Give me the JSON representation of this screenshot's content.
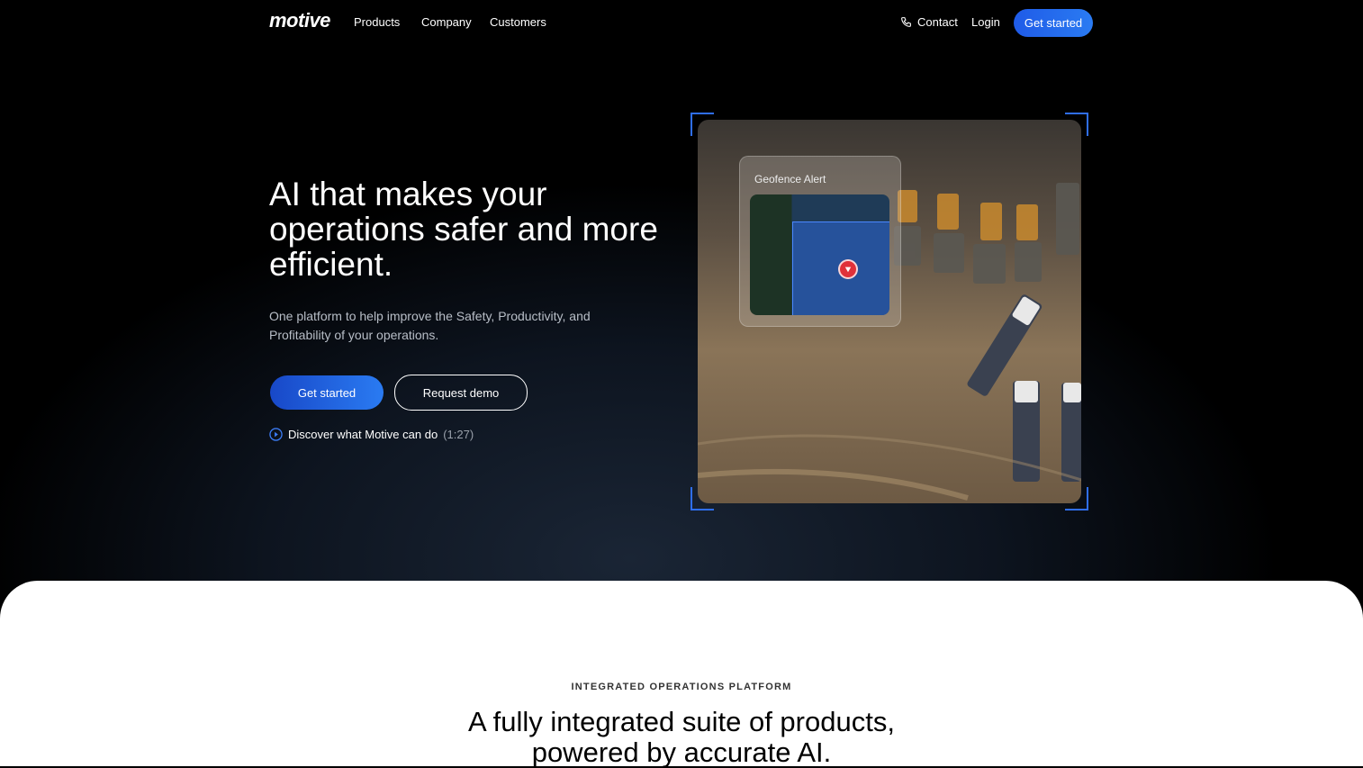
{
  "nav": {
    "logo": "motive",
    "links": [
      "Products",
      "Company",
      "Customers"
    ],
    "contact": "Contact",
    "login": "Login",
    "cta": "Get started"
  },
  "hero": {
    "headline": "AI that makes your operations safer and more efficient.",
    "subtext": "One platform to help improve the Safety, Productivity, and Profitability of your operations.",
    "primary_button": "Get started",
    "secondary_button": "Request demo",
    "discover_label": "Discover what Motive can do",
    "discover_duration": "(1:27)"
  },
  "image": {
    "alert_title": "Geofence Alert"
  },
  "section": {
    "eyebrow": "INTEGRATED OPERATIONS PLATFORM",
    "title": "A fully integrated suite of products, powered by accurate AI."
  },
  "colors": {
    "accent": "#2a7bf2",
    "background": "#000000",
    "alert_pin": "#e0313a"
  }
}
